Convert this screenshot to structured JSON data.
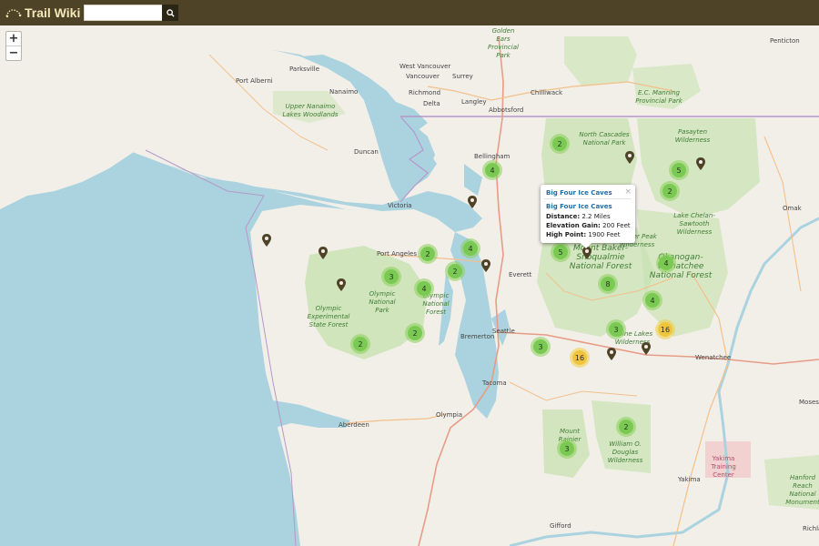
{
  "app": {
    "brand": "Trail Wiki",
    "logo_icon": "boot-print-icon",
    "header_color": "#4f4327",
    "brand_color": "#f4e8b8"
  },
  "search": {
    "value": "",
    "button_icon": "search-icon"
  },
  "zoom": {
    "in_label": "+",
    "out_label": "−"
  },
  "map": {
    "water_color": "#aad3df",
    "land_color": "#f2efe9",
    "park_color": "#c8e2b0",
    "city_labels": [
      "Port Alberni",
      "Parksville",
      "Nanaimo",
      "Vancouver",
      "West Vancouver",
      "Surrey",
      "Richmond",
      "Delta",
      "Langley",
      "Abbotsford",
      "Chilliwack",
      "Duncan",
      "Victoria",
      "Bellingham",
      "Port Angeles",
      "Everett",
      "Seattle",
      "Bremerton",
      "Tacoma",
      "Olympia",
      "Aberdeen",
      "Wenatchee",
      "Yakima",
      "Gifford",
      "Omak",
      "Penticton",
      "Moses",
      "Richland"
    ],
    "park_labels": [
      "Golden Ears Provincial Park",
      "E.C. Manning Provincial Park",
      "Upper Nanaimo Lakes Woodlands",
      "North Cascades National Park",
      "Pasayten Wilderness",
      "Lake Chelan-Sawtooth Wilderness",
      "Olympic National Park",
      "Olympic National Forest",
      "Olympic Experimental State Forest",
      "Mount Baker-Snoqualmie National Forest",
      "Okanogan-Wenatchee National Forest",
      "Glacier Peak Wilderness",
      "Alpine Lakes Wilderness",
      "Mount Rainier",
      "William O. Douglas Wilderness",
      "Yakima Training Center",
      "Hanford Reach National Monument"
    ]
  },
  "clusters": [
    {
      "count": "2",
      "color": "green"
    },
    {
      "count": "4",
      "color": "green"
    },
    {
      "count": "2",
      "color": "green"
    },
    {
      "count": "5",
      "color": "green"
    },
    {
      "count": "2",
      "color": "green"
    },
    {
      "count": "4",
      "color": "green"
    },
    {
      "count": "2",
      "color": "green"
    },
    {
      "count": "2",
      "color": "green"
    },
    {
      "count": "3",
      "color": "green"
    },
    {
      "count": "4",
      "color": "green"
    },
    {
      "count": "5",
      "color": "green"
    },
    {
      "count": "8",
      "color": "green"
    },
    {
      "count": "4",
      "color": "green"
    },
    {
      "count": "4",
      "color": "green"
    },
    {
      "count": "2",
      "color": "green"
    },
    {
      "count": "2",
      "color": "green"
    },
    {
      "count": "3",
      "color": "green"
    },
    {
      "count": "3",
      "color": "green"
    },
    {
      "count": "16",
      "color": "yellow"
    },
    {
      "count": "16",
      "color": "yellow"
    },
    {
      "count": "2",
      "color": "green"
    },
    {
      "count": "3",
      "color": "green"
    }
  ],
  "popup": {
    "title": "Big Four Ice Caves",
    "close": "×",
    "link": "Big Four Ice Caves",
    "distance_label": "Distance:",
    "distance_value": "2.2 Miles",
    "gain_label": "Elevation Gain:",
    "gain_value": "200 Feet",
    "high_label": "High Point:",
    "high_value": "1900 Feet"
  }
}
